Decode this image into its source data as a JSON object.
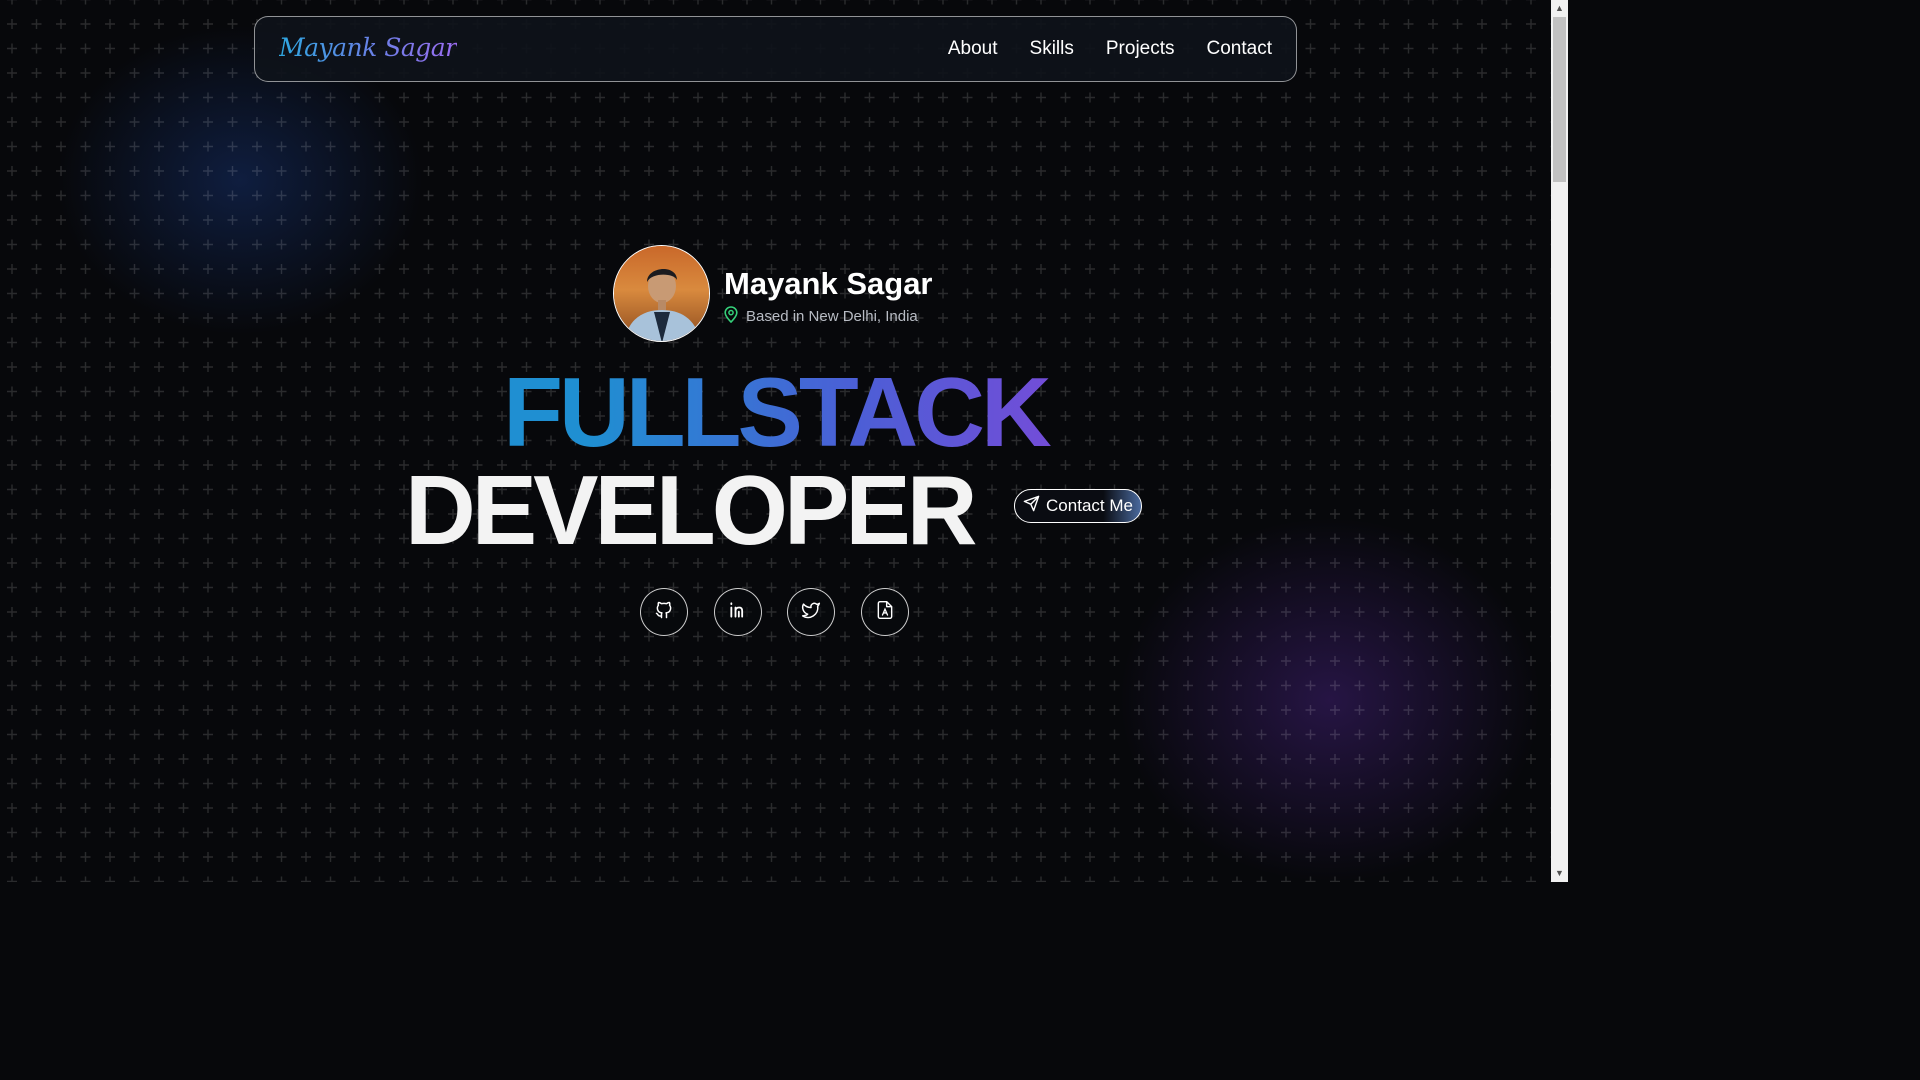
{
  "nav": {
    "logo": "Mayank Sagar",
    "links": [
      "About",
      "Skills",
      "Projects",
      "Contact"
    ]
  },
  "hero": {
    "name": "Mayank Sagar",
    "location": "Based in New Delhi, India",
    "headline_1": "FULLSTACK",
    "headline_2": "DEVELOPER",
    "contact_label": "Contact Me"
  },
  "social_icons": [
    "github-icon",
    "linkedin-icon",
    "twitter-icon",
    "resume-icon"
  ],
  "colors": {
    "background": "#07080b",
    "accent_blue": "#1f8fd2",
    "accent_purple": "#7a4ad8",
    "location_pin": "#35d07a"
  }
}
